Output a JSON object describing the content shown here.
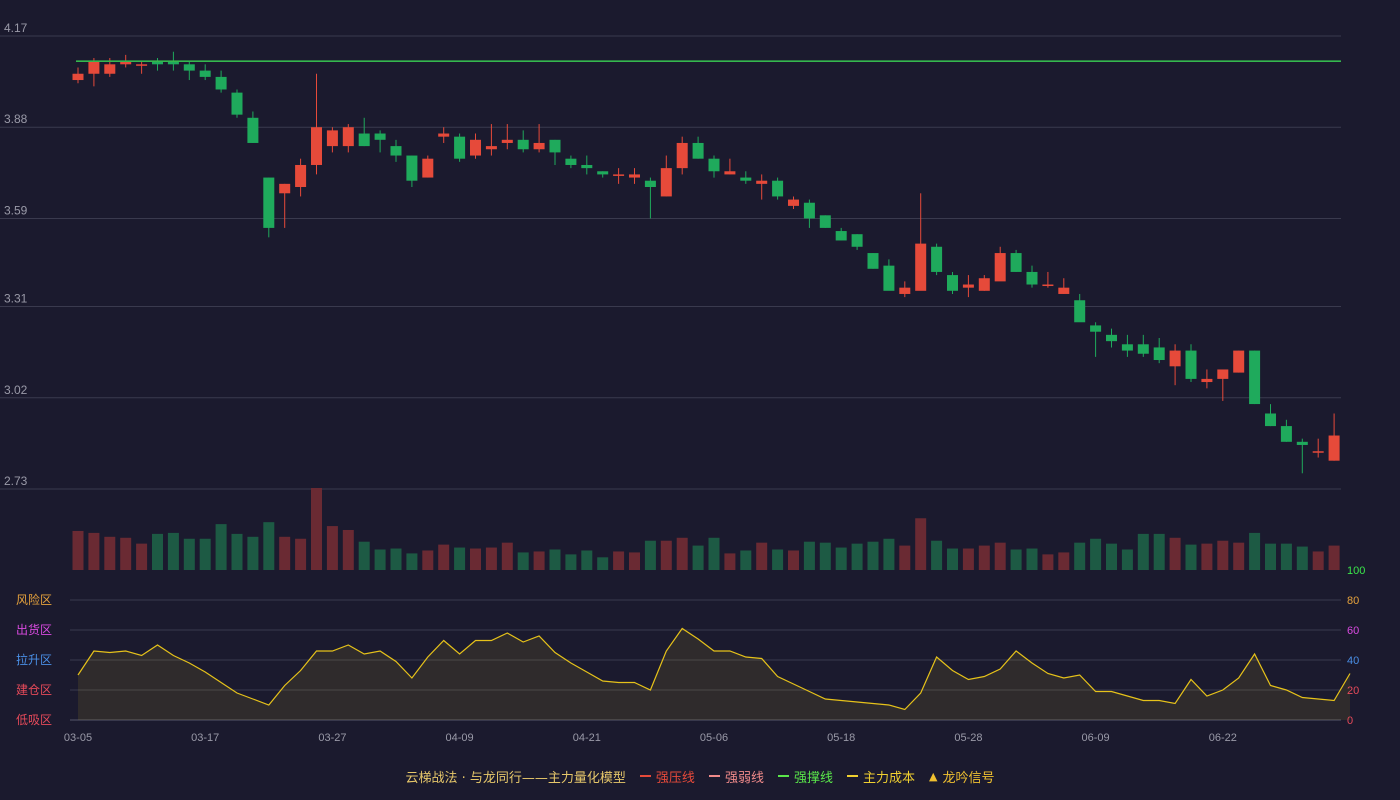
{
  "colors": {
    "background": "#1b1a2e",
    "grid": "#3a3a4e",
    "axis_text": "#9a9aa8",
    "up": "#e64a3a",
    "down": "#1faa5c",
    "vol_up": "#6a2a33",
    "vol_down": "#1d5a44",
    "resistance": "#35b84e",
    "strength": "#e6c21a",
    "zone_risk": "#e6a23c",
    "zone_distribution": "#d94ae0",
    "zone_lift": "#4a8fe6",
    "zone_build": "#e64a5a",
    "zone_low": "#e64a5a"
  },
  "legend": {
    "title": "云梯战法 · 与龙同行——主力量化模型",
    "items": [
      {
        "label": "强压线",
        "color": "#e64a3a",
        "style": "solid"
      },
      {
        "label": "强弱线",
        "color": "#f08a8a",
        "style": "dashed"
      },
      {
        "label": "强撑线",
        "color": "#5ae64a",
        "style": "solid"
      },
      {
        "label": "主力成本",
        "color": "#f0d030",
        "style": "dashed"
      },
      {
        "label": "龙吟信号",
        "color": "#f0c030",
        "style": "triangle"
      }
    ]
  },
  "chart_data": [
    {
      "type": "candlestick",
      "ylim": [
        2.73,
        4.17
      ],
      "yticks": [
        "4.17",
        "3.88",
        "3.59",
        "3.31",
        "3.02",
        "2.73"
      ],
      "xticks": [
        "03-05",
        "03-17",
        "03-27",
        "04-09",
        "04-21",
        "05-06",
        "05-18",
        "05-28",
        "06-09",
        "06-22"
      ],
      "xtick_index": [
        0,
        8,
        16,
        24,
        32,
        40,
        48,
        56,
        64,
        72
      ],
      "resistance_line": 4.09,
      "ohlc": [
        [
          4.03,
          4.07,
          4.02,
          4.05
        ],
        [
          4.05,
          4.1,
          4.01,
          4.09
        ],
        [
          4.05,
          4.1,
          4.04,
          4.08
        ],
        [
          4.08,
          4.11,
          4.07,
          4.09
        ],
        [
          4.08,
          4.09,
          4.05,
          4.08
        ],
        [
          4.09,
          4.1,
          4.06,
          4.08
        ],
        [
          4.09,
          4.12,
          4.06,
          4.08
        ],
        [
          4.08,
          4.09,
          4.03,
          4.06
        ],
        [
          4.06,
          4.08,
          4.03,
          4.04
        ],
        [
          4.04,
          4.06,
          3.99,
          4.0
        ],
        [
          3.99,
          4.0,
          3.91,
          3.92
        ],
        [
          3.91,
          3.93,
          3.83,
          3.83
        ],
        [
          3.72,
          3.72,
          3.53,
          3.56
        ],
        [
          3.67,
          3.7,
          3.56,
          3.7
        ],
        [
          3.69,
          3.78,
          3.66,
          3.76
        ],
        [
          3.76,
          4.05,
          3.73,
          3.88
        ],
        [
          3.82,
          3.88,
          3.8,
          3.87
        ],
        [
          3.82,
          3.89,
          3.8,
          3.88
        ],
        [
          3.86,
          3.91,
          3.82,
          3.82
        ],
        [
          3.86,
          3.87,
          3.8,
          3.84
        ],
        [
          3.82,
          3.84,
          3.77,
          3.79
        ],
        [
          3.79,
          3.79,
          3.69,
          3.71
        ],
        [
          3.72,
          3.79,
          3.72,
          3.78
        ],
        [
          3.85,
          3.88,
          3.83,
          3.86
        ],
        [
          3.85,
          3.86,
          3.77,
          3.78
        ],
        [
          3.79,
          3.86,
          3.78,
          3.84
        ],
        [
          3.81,
          3.89,
          3.79,
          3.82
        ],
        [
          3.83,
          3.89,
          3.81,
          3.84
        ],
        [
          3.84,
          3.87,
          3.8,
          3.81
        ],
        [
          3.81,
          3.89,
          3.8,
          3.83
        ],
        [
          3.84,
          3.84,
          3.76,
          3.8
        ],
        [
          3.78,
          3.79,
          3.75,
          3.76
        ],
        [
          3.76,
          3.79,
          3.73,
          3.75
        ],
        [
          3.74,
          3.74,
          3.72,
          3.73
        ],
        [
          3.73,
          3.75,
          3.7,
          3.73
        ],
        [
          3.72,
          3.75,
          3.7,
          3.73
        ],
        [
          3.71,
          3.72,
          3.59,
          3.69
        ],
        [
          3.66,
          3.79,
          3.66,
          3.75
        ],
        [
          3.75,
          3.85,
          3.73,
          3.83
        ],
        [
          3.83,
          3.85,
          3.78,
          3.78
        ],
        [
          3.78,
          3.79,
          3.72,
          3.74
        ],
        [
          3.73,
          3.78,
          3.73,
          3.74
        ],
        [
          3.72,
          3.74,
          3.7,
          3.71
        ],
        [
          3.7,
          3.73,
          3.65,
          3.71
        ],
        [
          3.71,
          3.72,
          3.65,
          3.66
        ],
        [
          3.63,
          3.66,
          3.62,
          3.65
        ],
        [
          3.64,
          3.65,
          3.56,
          3.59
        ],
        [
          3.6,
          3.6,
          3.56,
          3.56
        ],
        [
          3.55,
          3.56,
          3.52,
          3.52
        ],
        [
          3.54,
          3.54,
          3.49,
          3.5
        ],
        [
          3.48,
          3.48,
          3.43,
          3.43
        ],
        [
          3.44,
          3.46,
          3.37,
          3.36
        ],
        [
          3.35,
          3.39,
          3.34,
          3.37
        ],
        [
          3.36,
          3.67,
          3.38,
          3.51
        ],
        [
          3.5,
          3.51,
          3.41,
          3.42
        ],
        [
          3.41,
          3.42,
          3.35,
          3.36
        ],
        [
          3.37,
          3.41,
          3.34,
          3.38
        ],
        [
          3.36,
          3.41,
          3.36,
          3.4
        ],
        [
          3.39,
          3.5,
          3.4,
          3.48
        ],
        [
          3.48,
          3.49,
          3.42,
          3.42
        ],
        [
          3.42,
          3.44,
          3.37,
          3.38
        ],
        [
          3.38,
          3.42,
          3.37,
          3.38
        ],
        [
          3.35,
          3.4,
          3.35,
          3.37
        ],
        [
          3.33,
          3.35,
          3.27,
          3.26
        ],
        [
          3.25,
          3.26,
          3.15,
          3.23
        ],
        [
          3.22,
          3.24,
          3.18,
          3.2
        ],
        [
          3.19,
          3.22,
          3.15,
          3.17
        ],
        [
          3.19,
          3.22,
          3.15,
          3.16
        ],
        [
          3.18,
          3.21,
          3.13,
          3.14
        ],
        [
          3.12,
          3.19,
          3.06,
          3.17
        ],
        [
          3.17,
          3.19,
          3.07,
          3.08
        ],
        [
          3.07,
          3.11,
          3.05,
          3.08
        ],
        [
          3.08,
          3.1,
          3.01,
          3.11
        ],
        [
          3.1,
          3.17,
          3.1,
          3.17
        ],
        [
          3.17,
          3.17,
          3.0,
          3.0
        ],
        [
          2.97,
          3.0,
          2.93,
          2.93
        ],
        [
          2.93,
          2.95,
          2.88,
          2.88
        ],
        [
          2.88,
          2.89,
          2.78,
          2.87
        ],
        [
          2.85,
          2.89,
          2.83,
          2.85
        ],
        [
          2.82,
          2.97,
          2.82,
          2.9
        ]
      ],
      "volume": [
        40,
        38,
        34,
        33,
        27,
        37,
        38,
        32,
        32,
        47,
        37,
        34,
        49,
        34,
        32,
        84,
        45,
        41,
        29,
        21,
        22,
        17,
        20,
        26,
        23,
        22,
        23,
        28,
        18,
        19,
        21,
        16,
        20,
        13,
        19,
        18,
        30,
        30,
        33,
        25,
        33,
        17,
        20,
        28,
        21,
        20,
        29,
        28,
        23,
        27,
        29,
        32,
        25,
        53,
        30,
        22,
        22,
        25,
        28,
        21,
        22,
        16,
        18,
        28,
        32,
        27,
        21,
        37,
        37,
        33,
        26,
        27,
        30,
        28,
        38,
        27,
        27,
        24,
        19,
        25
      ]
    },
    {
      "type": "area",
      "ylim": [
        0,
        100
      ],
      "yticks": [
        "0",
        "20",
        "40",
        "60",
        "80",
        "100"
      ],
      "zones": [
        "风险区",
        "出货区",
        "拉升区",
        "建仓区",
        "低吸区"
      ],
      "values": [
        30,
        46,
        45,
        46,
        43,
        50,
        43,
        38,
        32,
        25,
        18,
        14,
        10,
        23,
        33,
        46,
        46,
        50,
        44,
        46,
        39,
        28,
        42,
        53,
        44,
        53,
        53,
        58,
        52,
        56,
        45,
        38,
        32,
        26,
        25,
        25,
        20,
        46,
        61,
        54,
        46,
        46,
        42,
        41,
        29,
        24,
        19,
        14,
        13,
        12,
        11,
        10,
        7,
        18,
        42,
        33,
        27,
        29,
        34,
        46,
        38,
        31,
        28,
        30,
        19,
        19,
        16,
        13,
        13,
        11,
        27,
        16,
        20,
        28,
        44,
        23,
        20,
        15,
        14,
        13,
        31
      ]
    }
  ]
}
